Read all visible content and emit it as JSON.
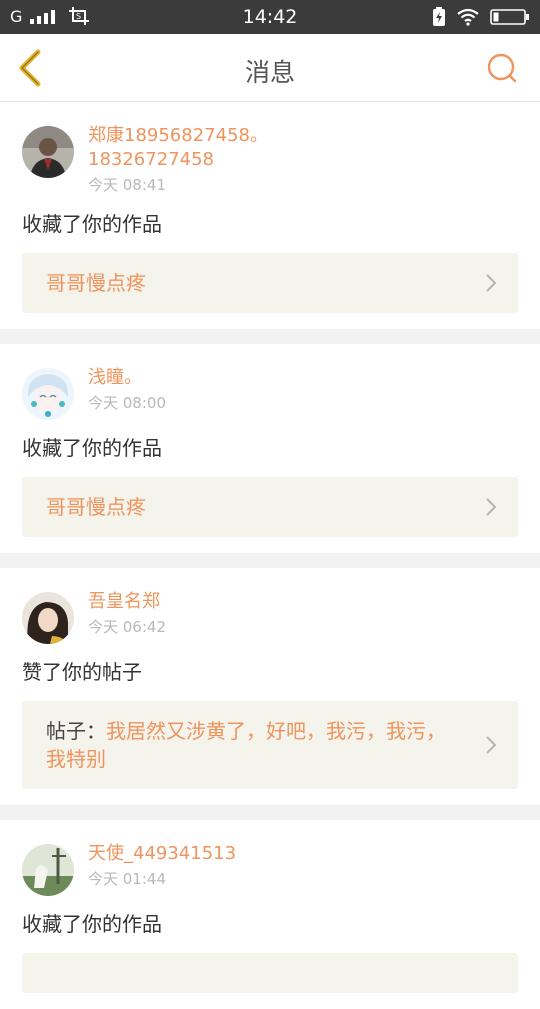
{
  "status_bar": {
    "carrier": "G",
    "time": "14:42",
    "icons": [
      "signal-icon",
      "screenshot-icon",
      "charge-icon",
      "wifi-icon",
      "battery-icon"
    ]
  },
  "nav": {
    "title": "消息",
    "back_icon": "back-chevron-icon",
    "search_icon": "search-icon"
  },
  "messages": [
    {
      "user": "郑康18956827458。18326727458",
      "user_line1": "郑康18956827458。",
      "user_line2": "18326727458",
      "time": "今天 08:41",
      "action": "收藏了你的作品",
      "target": "哥哥慢点疼"
    },
    {
      "user": "浅瞳。",
      "time": "今天 08:00",
      "action": "收藏了你的作品",
      "target": "哥哥慢点疼"
    },
    {
      "user": "吾皇名郑",
      "time": "今天 06:42",
      "action": "赞了你的帖子",
      "target_prefix": "帖子：",
      "target": "我居然又涉黄了，好吧，我污，我污，我特别"
    },
    {
      "user": "天使_449341513",
      "time": "今天 01:44",
      "action": "收藏了你的作品"
    }
  ],
  "colors": {
    "accent": "#f0935c",
    "status_bar": "#3b3b3b",
    "card_box": "#f4f3ec",
    "back_icon": "#e3b22c"
  }
}
